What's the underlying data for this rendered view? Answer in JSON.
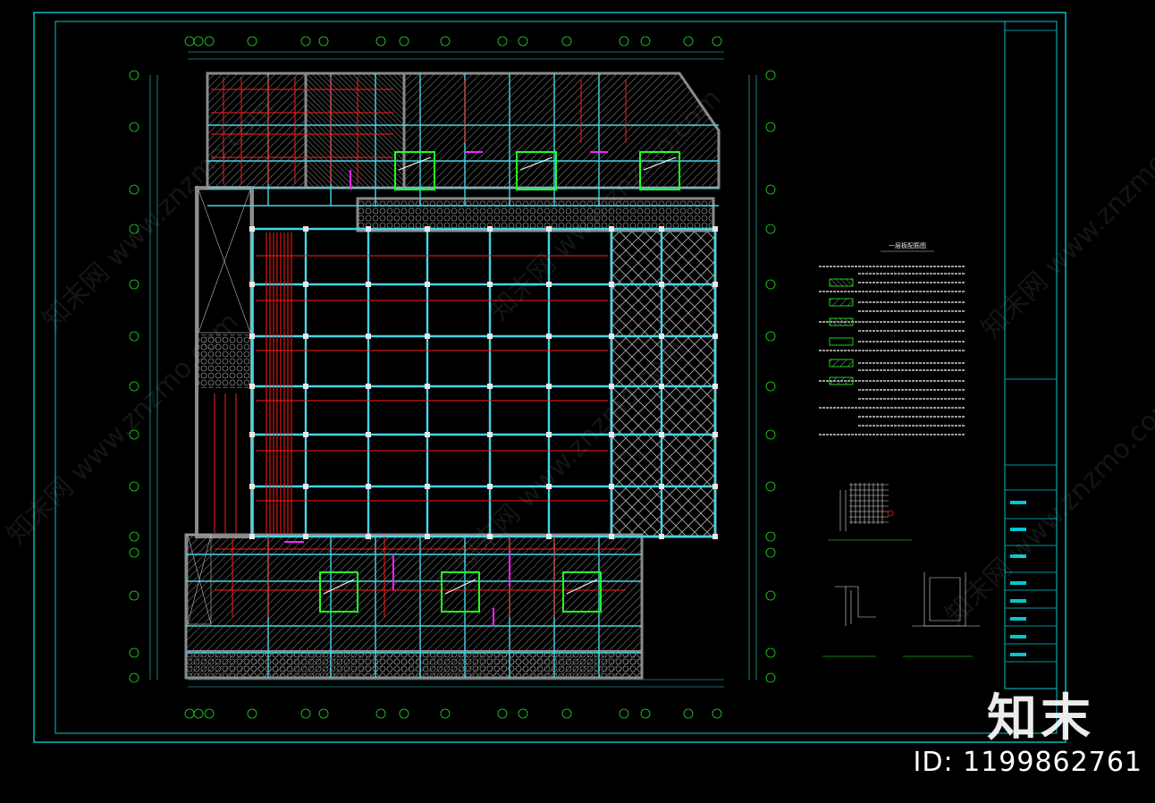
{
  "drawing": {
    "notes_title": "一层板配筋图",
    "brand": "知末",
    "image_id": "ID: 1199862761",
    "watermark_text": "知末网 www.znzmo.com"
  },
  "colors": {
    "frame": "#00c8d0",
    "beam": "#44d6e6",
    "rebar": "#ff1a1a",
    "wall": "#8a8a8a",
    "hatch": "#9a9a9a",
    "accent_green": "#22ff22",
    "accent_magenta": "#ff22ff",
    "axis_bubble": "#22dd22",
    "text": "#e8e8e8"
  },
  "icons": {
    "axis": "circle-bubble-icon",
    "column": "square-column-icon"
  }
}
